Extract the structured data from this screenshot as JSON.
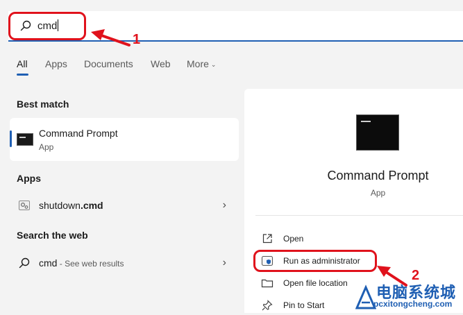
{
  "search": {
    "query": "cmd"
  },
  "tabs": [
    {
      "label": "All",
      "active": true
    },
    {
      "label": "Apps"
    },
    {
      "label": "Documents"
    },
    {
      "label": "Web"
    },
    {
      "label": "More"
    }
  ],
  "left": {
    "best_match_header": "Best match",
    "best_match": {
      "title": "Command Prompt",
      "subtitle": "App"
    },
    "apps_header": "Apps",
    "app_result": {
      "name": "shutdown",
      "ext": ".cmd"
    },
    "web_header": "Search the web",
    "web_result": {
      "query": "cmd",
      "suffix": " - See web results"
    }
  },
  "detail": {
    "title": "Command Prompt",
    "subtitle": "App",
    "actions": [
      {
        "label": "Open",
        "icon": "open-external-icon"
      },
      {
        "label": "Run as administrator",
        "icon": "shield-icon"
      },
      {
        "label": "Open file location",
        "icon": "folder-icon"
      },
      {
        "label": "Pin to Start",
        "icon": "pin-icon"
      }
    ]
  },
  "annotations": {
    "step1": "1",
    "step2": "2"
  },
  "watermark": {
    "main": "电脑系统城",
    "sub": "pcxitongcheng.com"
  },
  "colors": {
    "accent": "#1f5fb3",
    "annotation": "#e0121c"
  }
}
